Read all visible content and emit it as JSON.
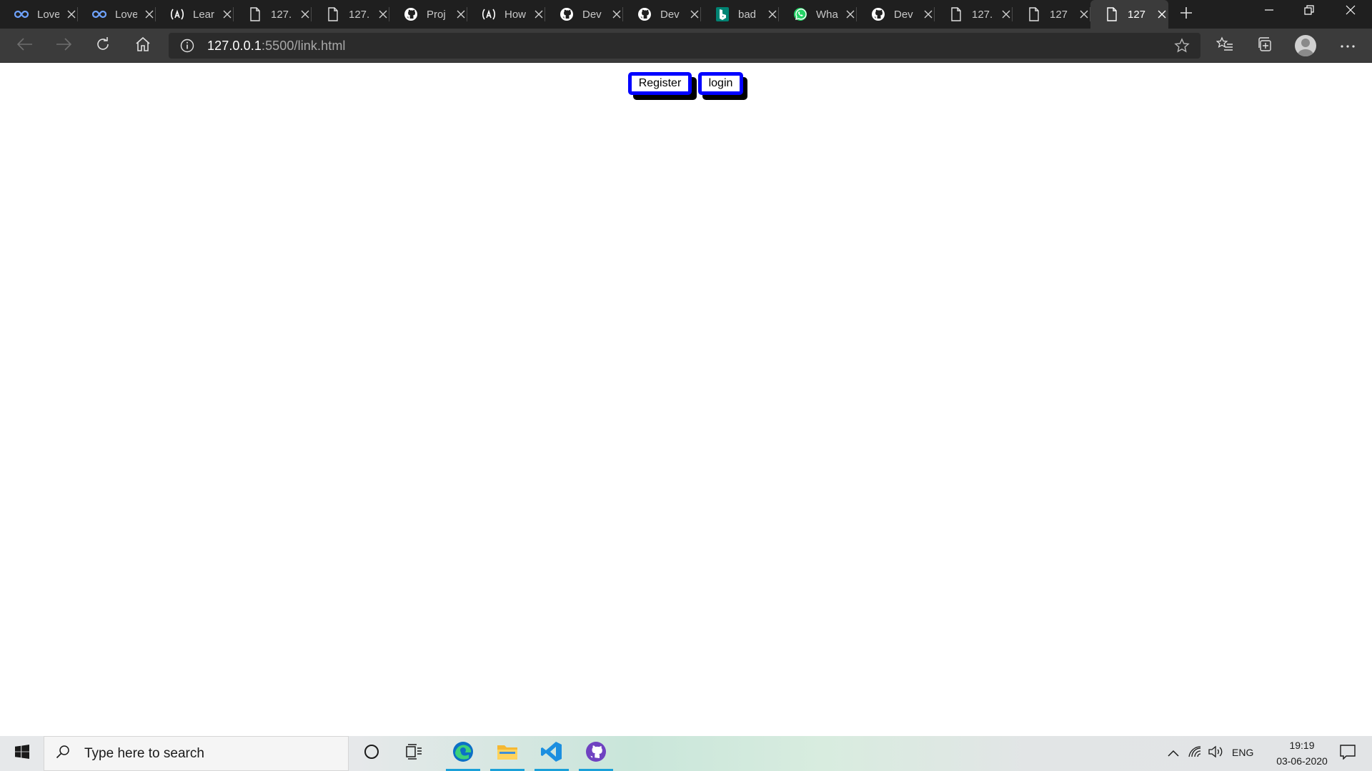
{
  "tabs": [
    {
      "title": "Love",
      "icon": "infinity-icon"
    },
    {
      "title": "Love",
      "icon": "infinity-icon"
    },
    {
      "title": "Learn",
      "icon": "lambda-icon"
    },
    {
      "title": "127.",
      "icon": "page-icon"
    },
    {
      "title": "127.",
      "icon": "page-icon"
    },
    {
      "title": "Proj",
      "icon": "github-icon"
    },
    {
      "title": "How",
      "icon": "lambda-icon"
    },
    {
      "title": "Dev",
      "icon": "github-icon"
    },
    {
      "title": "Dev",
      "icon": "github-icon"
    },
    {
      "title": "bad",
      "icon": "bing-icon"
    },
    {
      "title": "Wha",
      "icon": "whatsapp-icon"
    },
    {
      "title": "Dev",
      "icon": "github-icon"
    },
    {
      "title": "127.",
      "icon": "page-icon"
    },
    {
      "title": "127",
      "icon": "page-icon"
    },
    {
      "title": "127",
      "icon": "page-icon",
      "active": true
    }
  ],
  "address": {
    "host": "127.0.0.1",
    "rest": ":5500/link.html"
  },
  "page": {
    "register_label": "Register",
    "login_label": "login"
  },
  "taskbar": {
    "search_placeholder": "Type here to search",
    "language": "ENG",
    "time": "19:19",
    "date": "03-06-2020"
  },
  "colors": {
    "button_border": "#0000ff",
    "button_shadow": "#000000",
    "tabstrip_bg": "#1f1f1f",
    "toolbar_bg": "#3b3b3b"
  }
}
